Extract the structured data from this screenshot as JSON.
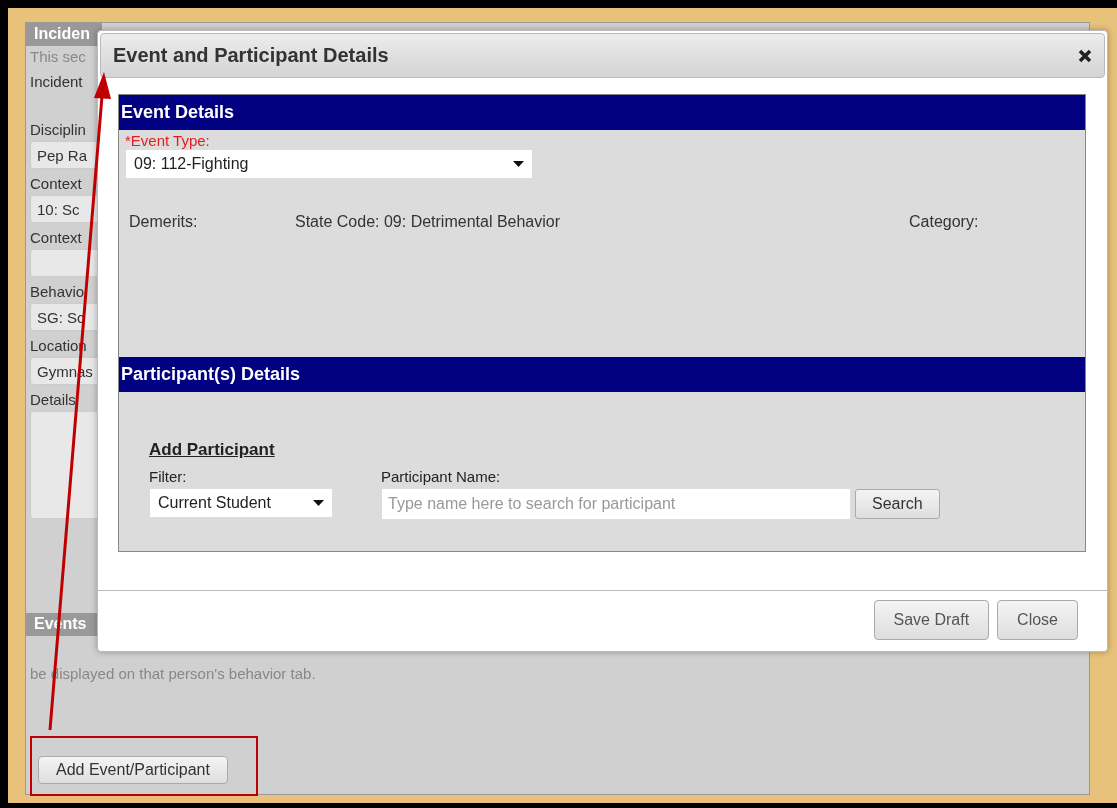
{
  "incident_section": {
    "header": "Inciden",
    "description": "This sec",
    "fields": [
      {
        "kind": "text",
        "label": "Incident"
      },
      {
        "kind": "select",
        "label": "Disciplin",
        "value": "Pep Ra"
      },
      {
        "kind": "select",
        "label": "Context",
        "value": "10: Sc"
      },
      {
        "kind": "select",
        "label": "Context"
      },
      {
        "kind": "select",
        "label": "Behavio",
        "value": "SG: Sc"
      },
      {
        "kind": "select",
        "label": "Location",
        "value": "Gymnas"
      },
      {
        "kind": "textarea",
        "label": "Details"
      }
    ]
  },
  "events_section": {
    "header": "Events",
    "description": "be displayed on that person's behavior tab.",
    "button": "Add Event/Participant"
  },
  "dialog": {
    "title": "Event and Participant Details",
    "event_details": {
      "header": "Event Details",
      "event_type": {
        "label": "*Event Type:",
        "required": true,
        "value": "09: 112-Fighting"
      },
      "info": [
        "Demerits:",
        "State Code: 09: Detrimental Behavior",
        "Category:"
      ]
    },
    "participant_details": {
      "header": "Participant(s) Details",
      "subheader": "Add Participant",
      "filter": {
        "label": "Filter:",
        "value": "Current Student"
      },
      "name": {
        "label": "Participant Name:",
        "placeholder": "Type name here to search for participant"
      },
      "search_button": "Search"
    },
    "buttons": [
      "Save Draft",
      "Close"
    ]
  }
}
